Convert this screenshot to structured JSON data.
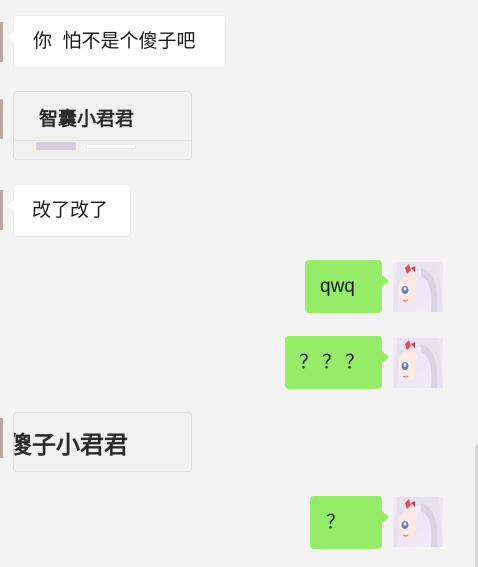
{
  "messages": {
    "m1": {
      "text": "你  怕不是个傻子吧"
    },
    "m2": {
      "sticker_text": "智囊小君君"
    },
    "m3": {
      "text": "改了改了"
    },
    "m4": {
      "text": "qwq"
    },
    "m5": {
      "text": "？？？"
    },
    "m6": {
      "sticker_text": "傻子小君君"
    },
    "m7": {
      "text": "？"
    }
  },
  "colors": {
    "background": "#f3f3f3",
    "incoming_bubble": "#ffffff",
    "outgoing_bubble": "#95ec69"
  },
  "icons": {
    "self_avatar": "anime-girl-avatar"
  }
}
